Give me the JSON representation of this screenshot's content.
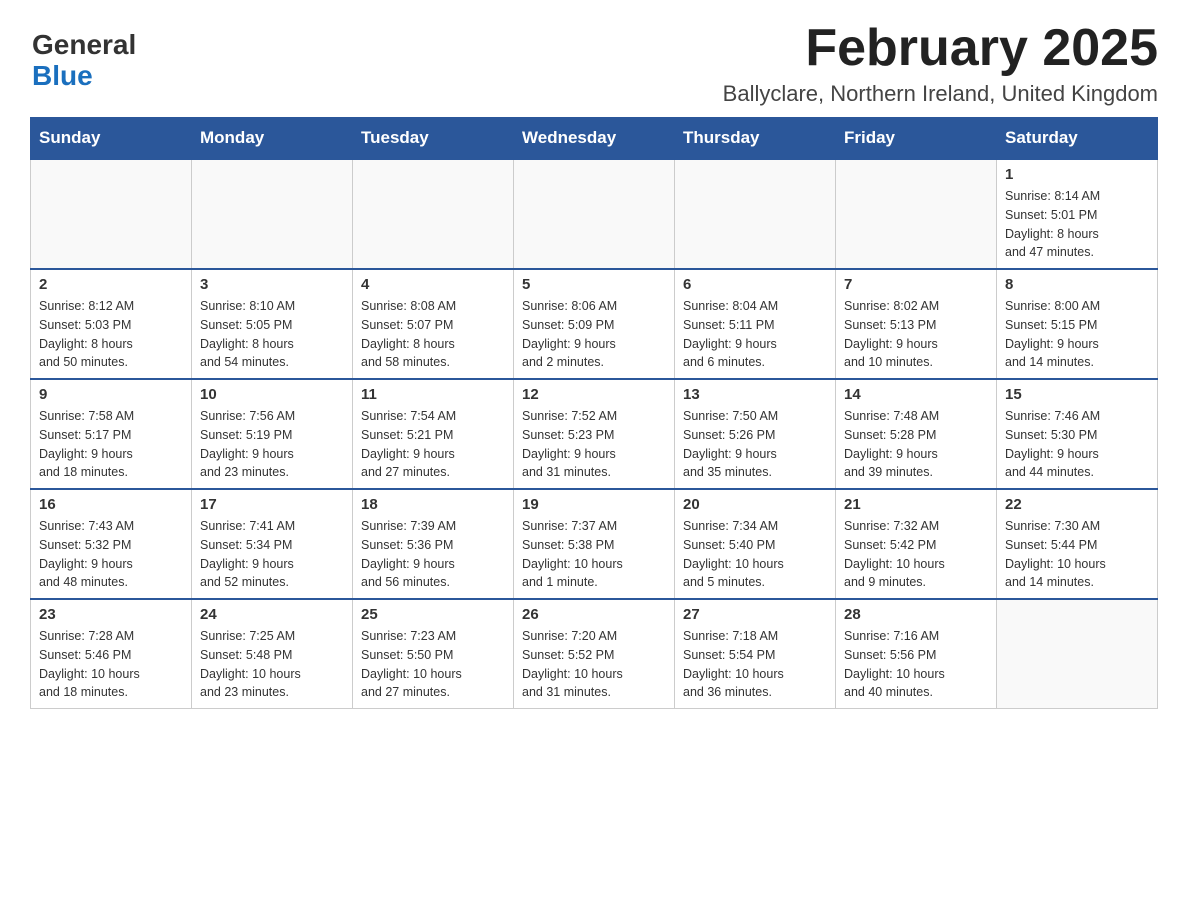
{
  "logo": {
    "general": "General",
    "blue": "Blue"
  },
  "header": {
    "month": "February 2025",
    "location": "Ballyclare, Northern Ireland, United Kingdom"
  },
  "weekdays": [
    "Sunday",
    "Monday",
    "Tuesday",
    "Wednesday",
    "Thursday",
    "Friday",
    "Saturday"
  ],
  "weeks": [
    [
      {
        "day": "",
        "info": ""
      },
      {
        "day": "",
        "info": ""
      },
      {
        "day": "",
        "info": ""
      },
      {
        "day": "",
        "info": ""
      },
      {
        "day": "",
        "info": ""
      },
      {
        "day": "",
        "info": ""
      },
      {
        "day": "1",
        "info": "Sunrise: 8:14 AM\nSunset: 5:01 PM\nDaylight: 8 hours\nand 47 minutes."
      }
    ],
    [
      {
        "day": "2",
        "info": "Sunrise: 8:12 AM\nSunset: 5:03 PM\nDaylight: 8 hours\nand 50 minutes."
      },
      {
        "day": "3",
        "info": "Sunrise: 8:10 AM\nSunset: 5:05 PM\nDaylight: 8 hours\nand 54 minutes."
      },
      {
        "day": "4",
        "info": "Sunrise: 8:08 AM\nSunset: 5:07 PM\nDaylight: 8 hours\nand 58 minutes."
      },
      {
        "day": "5",
        "info": "Sunrise: 8:06 AM\nSunset: 5:09 PM\nDaylight: 9 hours\nand 2 minutes."
      },
      {
        "day": "6",
        "info": "Sunrise: 8:04 AM\nSunset: 5:11 PM\nDaylight: 9 hours\nand 6 minutes."
      },
      {
        "day": "7",
        "info": "Sunrise: 8:02 AM\nSunset: 5:13 PM\nDaylight: 9 hours\nand 10 minutes."
      },
      {
        "day": "8",
        "info": "Sunrise: 8:00 AM\nSunset: 5:15 PM\nDaylight: 9 hours\nand 14 minutes."
      }
    ],
    [
      {
        "day": "9",
        "info": "Sunrise: 7:58 AM\nSunset: 5:17 PM\nDaylight: 9 hours\nand 18 minutes."
      },
      {
        "day": "10",
        "info": "Sunrise: 7:56 AM\nSunset: 5:19 PM\nDaylight: 9 hours\nand 23 minutes."
      },
      {
        "day": "11",
        "info": "Sunrise: 7:54 AM\nSunset: 5:21 PM\nDaylight: 9 hours\nand 27 minutes."
      },
      {
        "day": "12",
        "info": "Sunrise: 7:52 AM\nSunset: 5:23 PM\nDaylight: 9 hours\nand 31 minutes."
      },
      {
        "day": "13",
        "info": "Sunrise: 7:50 AM\nSunset: 5:26 PM\nDaylight: 9 hours\nand 35 minutes."
      },
      {
        "day": "14",
        "info": "Sunrise: 7:48 AM\nSunset: 5:28 PM\nDaylight: 9 hours\nand 39 minutes."
      },
      {
        "day": "15",
        "info": "Sunrise: 7:46 AM\nSunset: 5:30 PM\nDaylight: 9 hours\nand 44 minutes."
      }
    ],
    [
      {
        "day": "16",
        "info": "Sunrise: 7:43 AM\nSunset: 5:32 PM\nDaylight: 9 hours\nand 48 minutes."
      },
      {
        "day": "17",
        "info": "Sunrise: 7:41 AM\nSunset: 5:34 PM\nDaylight: 9 hours\nand 52 minutes."
      },
      {
        "day": "18",
        "info": "Sunrise: 7:39 AM\nSunset: 5:36 PM\nDaylight: 9 hours\nand 56 minutes."
      },
      {
        "day": "19",
        "info": "Sunrise: 7:37 AM\nSunset: 5:38 PM\nDaylight: 10 hours\nand 1 minute."
      },
      {
        "day": "20",
        "info": "Sunrise: 7:34 AM\nSunset: 5:40 PM\nDaylight: 10 hours\nand 5 minutes."
      },
      {
        "day": "21",
        "info": "Sunrise: 7:32 AM\nSunset: 5:42 PM\nDaylight: 10 hours\nand 9 minutes."
      },
      {
        "day": "22",
        "info": "Sunrise: 7:30 AM\nSunset: 5:44 PM\nDaylight: 10 hours\nand 14 minutes."
      }
    ],
    [
      {
        "day": "23",
        "info": "Sunrise: 7:28 AM\nSunset: 5:46 PM\nDaylight: 10 hours\nand 18 minutes."
      },
      {
        "day": "24",
        "info": "Sunrise: 7:25 AM\nSunset: 5:48 PM\nDaylight: 10 hours\nand 23 minutes."
      },
      {
        "day": "25",
        "info": "Sunrise: 7:23 AM\nSunset: 5:50 PM\nDaylight: 10 hours\nand 27 minutes."
      },
      {
        "day": "26",
        "info": "Sunrise: 7:20 AM\nSunset: 5:52 PM\nDaylight: 10 hours\nand 31 minutes."
      },
      {
        "day": "27",
        "info": "Sunrise: 7:18 AM\nSunset: 5:54 PM\nDaylight: 10 hours\nand 36 minutes."
      },
      {
        "day": "28",
        "info": "Sunrise: 7:16 AM\nSunset: 5:56 PM\nDaylight: 10 hours\nand 40 minutes."
      },
      {
        "day": "",
        "info": ""
      }
    ]
  ]
}
